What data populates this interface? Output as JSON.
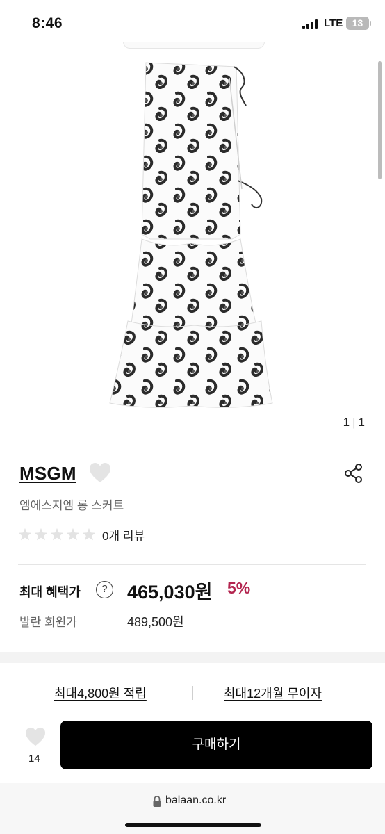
{
  "status_bar": {
    "time": "8:46",
    "network": "LTE",
    "battery": "13"
  },
  "image_counter": {
    "current": "1",
    "total": "1"
  },
  "product": {
    "brand": "MSGM",
    "name": "엠에스지엠 롱 스커트",
    "rating_stars": 0,
    "review_link": "0개 리뷰"
  },
  "price": {
    "label": "최대 혜택가",
    "help_icon": "?",
    "value": "465,030원",
    "discount": "5%",
    "member_label": "발란 회원가",
    "member_price": "489,500원"
  },
  "benefits": {
    "points": "최대4,800원 적립",
    "installment": "최대12개월 무이자"
  },
  "bottom_bar": {
    "wish_count": "14",
    "buy_label": "구매하기"
  },
  "browser": {
    "url": "balaan.co.kr"
  },
  "icons": {
    "wish": "heart-icon",
    "share": "share-icon",
    "help": "question-circle-icon",
    "lock": "lock-icon",
    "star": "star-icon"
  },
  "colors": {
    "discount": "#b3254f",
    "button_bg": "#000000",
    "heart_fill": "#e4e4e4",
    "star_fill": "#e3e3e3"
  }
}
